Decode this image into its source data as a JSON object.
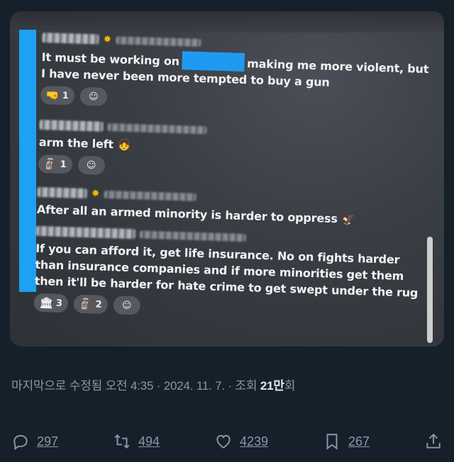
{
  "messages": [
    {
      "text_before": "It must be working on",
      "text_after": "making me more violent, but I have never been more tempted to buy a gun",
      "reactions": [
        {
          "emoji": "🤜",
          "count": "1"
        }
      ],
      "has_sun": true
    },
    {
      "text": "arm the left 👧",
      "reactions": [
        {
          "emoji": "🗿",
          "count": "1"
        }
      ],
      "has_sun": false
    },
    {
      "text": "After all an armed minority is harder to oppress 🦅",
      "reactions": [],
      "has_sun": true
    },
    {
      "text": "If you can afford it, get life insurance. No on fights harder than insurance companies and if more minorities get them then it'll be harder for hate crime to get swept under the rug",
      "reactions": [
        {
          "emoji": "🏛",
          "count": "3"
        },
        {
          "emoji": "🗿",
          "count": "2"
        }
      ],
      "has_sun": false
    }
  ],
  "meta": {
    "prefix": "마지막으로 수정됨 오전 4:35 · 2024. 11. 7. · 조회 ",
    "views": "21만",
    "suffix": "회"
  },
  "actions": {
    "replies": "297",
    "reposts": "494",
    "likes": "4239",
    "bookmarks": "267"
  }
}
